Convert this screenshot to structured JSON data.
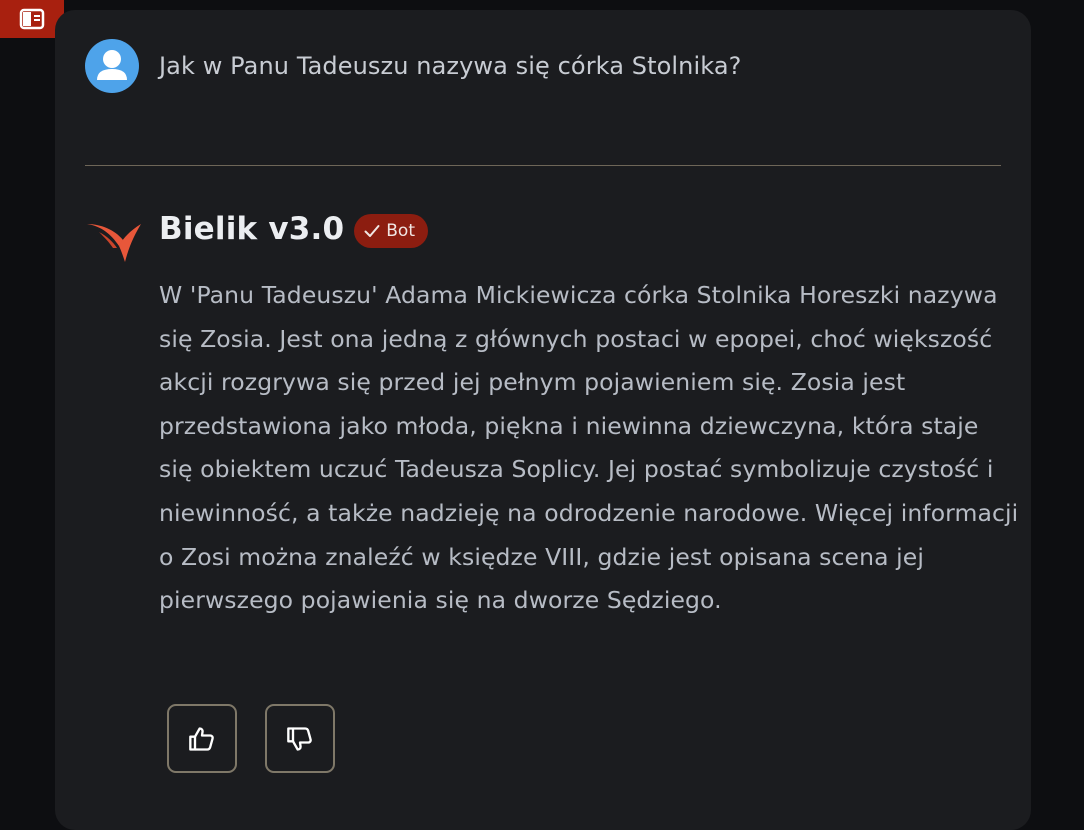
{
  "sidebar": {
    "toggle_icon": "sidebar-panel-icon"
  },
  "user_turn": {
    "avatar_icon": "user-avatar-icon",
    "message": "Jak w Panu Tadeuszu nazywa się córka Stolnika?"
  },
  "bot_turn": {
    "logo_icon": "bird-logo-icon",
    "name": "Bielik v3.0",
    "badge": "Bot",
    "badge_icon": "checkmark-icon",
    "message": "W 'Panu Tadeuszu' Adama Mickiewicza córka Stolnika Horeszki nazywa się Zosia. Jest ona jedną z głównych postaci w epopei, choć większość akcji rozgrywa się przed jej pełnym pojawieniem się. Zosia jest przedstawiona jako młoda, piękna i niewinna dziewczyna, która staje się obiektem uczuć Tadeusza Soplicy. Jej postać symbolizuje czystość i niewinność, a także nadzieję na odrodzenie narodowe. Więcej informacji o Zosi można znaleźć w księdze VIII, gdzie jest opisana scena jej pierwszego pojawienia się na dworze Sędziego."
  },
  "feedback": {
    "like_icon": "thumbs-up-icon",
    "dislike_icon": "thumbs-down-icon"
  },
  "colors": {
    "accent": "#a8200f",
    "badge_bg": "#8c1d10",
    "avatar": "#4ea3ea",
    "logo": "#e8573a",
    "panel": "#1b1c1f"
  }
}
